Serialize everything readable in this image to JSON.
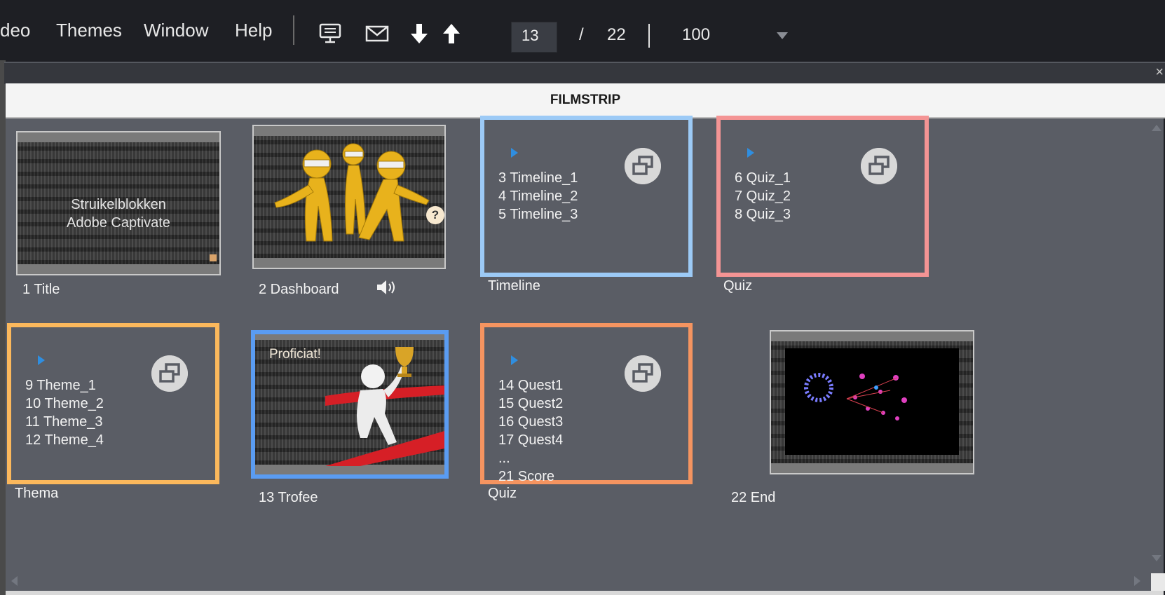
{
  "menu": {
    "video": "deo",
    "themes": "Themes",
    "window": "Window",
    "help": "Help"
  },
  "toolbar": {
    "icons": [
      "presentation-icon",
      "mail-icon",
      "arrow-down-icon",
      "arrow-up-icon"
    ],
    "current_slide": "13",
    "slash": "/",
    "total_slides": "22",
    "zoom": "100"
  },
  "panel": {
    "title": "FILMSTRIP",
    "close": "×"
  },
  "slides": {
    "title": {
      "text_line1": "Struikelblokken",
      "text_line2": "Adobe Captivate",
      "label": "1 Title"
    },
    "dashboard": {
      "label": "2 Dashboard",
      "help": "?"
    },
    "timeline": {
      "items": [
        "3 Timeline_1",
        "4 Timeline_2",
        "5 Timeline_3"
      ],
      "label": "Timeline",
      "color": "#9ccaf6"
    },
    "quiz1": {
      "items": [
        "6 Quiz_1",
        "7 Quiz_2",
        "8 Quiz_3"
      ],
      "label": "Quiz",
      "color": "#f49494"
    },
    "thema": {
      "items": [
        "9 Theme_1",
        "10 Theme_2",
        "11 Theme_3",
        "12 Theme_4"
      ],
      "label": "Thema",
      "color": "#fbb85c"
    },
    "trofee": {
      "text": "Proficiat!",
      "label": "13 Trofee",
      "selected_color": "#5a9cf2"
    },
    "quiz2": {
      "items": [
        "14 Quest1",
        "15 Quest2",
        "16 Quest3",
        "17 Quest4",
        "...",
        "21 Score"
      ],
      "label": "Quiz",
      "color": "#f59460"
    },
    "end": {
      "label": "22 End"
    }
  }
}
